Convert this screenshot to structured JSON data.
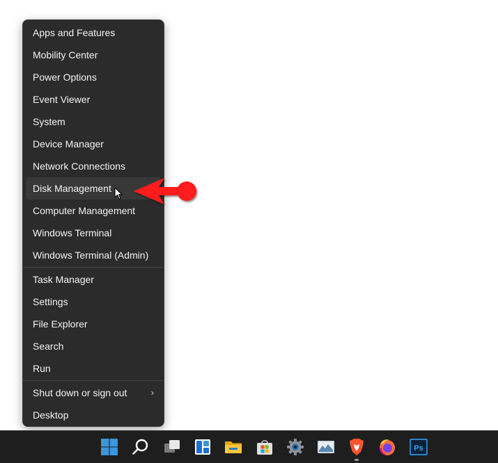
{
  "context_menu": {
    "group1": [
      {
        "label": "Apps and Features"
      },
      {
        "label": "Mobility Center"
      },
      {
        "label": "Power Options"
      },
      {
        "label": "Event Viewer"
      },
      {
        "label": "System"
      },
      {
        "label": "Device Manager"
      },
      {
        "label": "Network Connections"
      },
      {
        "label": "Disk Management",
        "hovered": true
      },
      {
        "label": "Computer Management"
      },
      {
        "label": "Windows Terminal"
      },
      {
        "label": "Windows Terminal (Admin)"
      }
    ],
    "group2": [
      {
        "label": "Task Manager"
      },
      {
        "label": "Settings"
      },
      {
        "label": "File Explorer"
      },
      {
        "label": "Search"
      },
      {
        "label": "Run"
      }
    ],
    "group3": [
      {
        "label": "Shut down or sign out",
        "submenu_icon": "chevron-right-icon"
      },
      {
        "label": "Desktop"
      }
    ],
    "submenu_glyph": "›"
  },
  "annotation": {
    "arrow_color": "#ff1a1a",
    "points_to": "Disk Management"
  },
  "taskbar": {
    "icons": [
      "windows-start-icon",
      "search-icon",
      "task-view-icon",
      "widgets-icon",
      "file-explorer-icon",
      "microsoft-store-icon",
      "settings-icon",
      "photos-icon",
      "brave-browser-icon",
      "firefox-icon",
      "photoshop-icon"
    ],
    "photoshop_label": "Ps"
  },
  "colors": {
    "menu_bg": "#2b2b2b",
    "menu_hover": "#383838",
    "menu_text": "#f3f3f3",
    "taskbar_bg": "#1e1e1e",
    "start_blue": "#3a96dd"
  }
}
